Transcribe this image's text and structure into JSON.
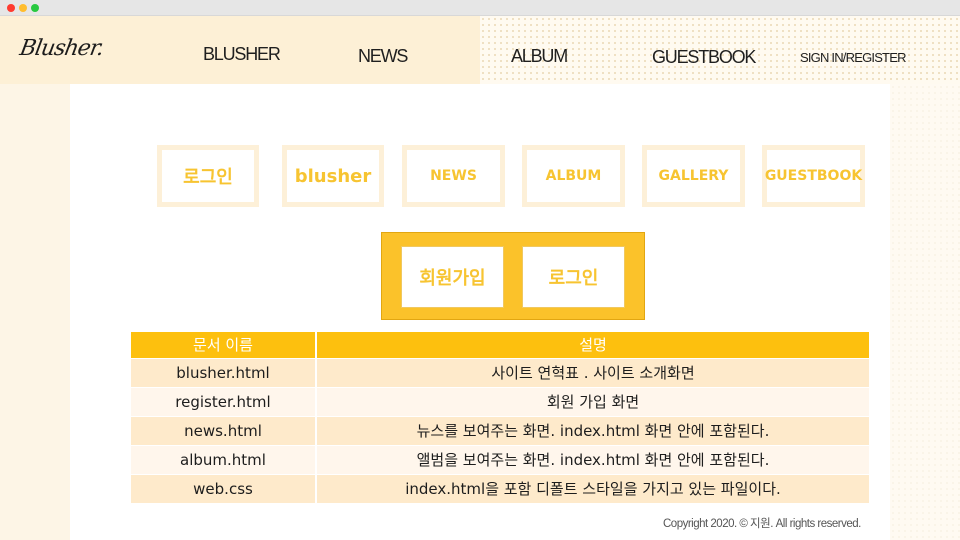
{
  "logo": {
    "text": "Blusher."
  },
  "nav": {
    "blusher": "BLUSHER",
    "news": "NEWS",
    "album": "ALBUM",
    "guestbook": "GUESTBOOK",
    "sign": "SIGN IN/REGISTER"
  },
  "menu": {
    "items": [
      {
        "label": "로그인"
      },
      {
        "label": "blusher"
      },
      {
        "label": "NEWS"
      },
      {
        "label": "ALBUM"
      },
      {
        "label": "GALLERY"
      },
      {
        "label": "GUESTBOOK"
      }
    ]
  },
  "auth": {
    "join": "회원가입",
    "login": "로그인"
  },
  "table": {
    "headers": [
      "문서 이름",
      "설명"
    ],
    "rows": [
      {
        "name": "blusher.html",
        "desc": "사이트 연혁표 . 사이트 소개화면"
      },
      {
        "name": "register.html",
        "desc": "회원 가입 화면"
      },
      {
        "name": "news.html",
        "desc": "뉴스를 보여주는 화면. index.html 화면 안에 포함된다."
      },
      {
        "name": "album.html",
        "desc": "앨범을 보여주는 화면. index.html 화면 안에 포함된다."
      },
      {
        "name": "web.css",
        "desc": "index.html을 포함 디폴트 스타일을 가지고 있는 파일이다."
      }
    ]
  },
  "footer": {
    "text": "Copyright 2020. © 지원. All rights reserved."
  },
  "colors": {
    "accent": "#fdc00e",
    "menu_text": "#f7c431",
    "row_odd": "#feeacb",
    "row_even": "#fff6ec"
  }
}
